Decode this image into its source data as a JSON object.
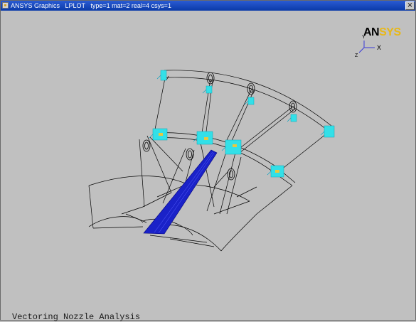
{
  "window": {
    "title": "ANSYS Graphics   LPLOT   type=1 mat=2 real=4 csys=1",
    "close_glyph": "×"
  },
  "logo": {
    "prefix": "AN",
    "suffix": "SYS"
  },
  "triad": {
    "x_label": "X",
    "y_label": "Y",
    "z_label": "Z"
  },
  "caption": "Vectoring Nozzle Analysis",
  "colors": {
    "background": "#c0c0c0",
    "title_bar": "#0a3aa8",
    "logo_accent": "#e8b818",
    "triad_axes": "#3a3ad8",
    "mesh_band": "#1a22c8",
    "constraints": "#33e0e8",
    "constraint_highlight": "#e8c840",
    "wireframe": "#000000"
  }
}
